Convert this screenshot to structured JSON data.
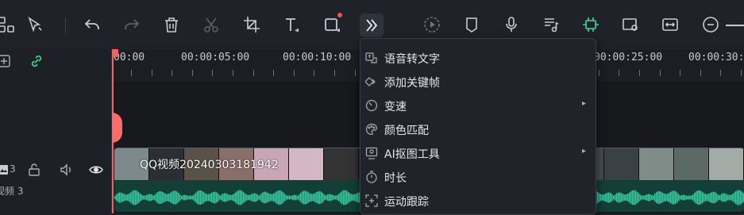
{
  "toolbar": {
    "icons": [
      "grid-icon",
      "select-arrow-icon",
      "undo-icon",
      "redo-icon",
      "delete-icon",
      "cut-icon",
      "crop-icon",
      "text-icon",
      "shape-icon",
      "more-tools-icon",
      "play-circle-icon",
      "marker-icon",
      "microphone-icon",
      "music-list-icon",
      "ai-icon",
      "render-preview-icon",
      "fit-icon",
      "zoom-out-icon"
    ],
    "accent": "#3ddc97"
  },
  "ruler": {
    "labels": [
      "00:00",
      "00:00:05:00",
      "00:00:10:00",
      "00:00:25:00",
      "00:00:30:0"
    ]
  },
  "track": {
    "number": "3",
    "name": "视频 3"
  },
  "clip": {
    "title": "QQ视频20240303181942"
  },
  "context_menu": {
    "items": [
      {
        "label": "语音转文字",
        "icon": "speech-to-text-icon",
        "submenu": false
      },
      {
        "label": "添加关键帧",
        "icon": "keyframe-icon",
        "submenu": false
      },
      {
        "label": "变速",
        "icon": "speed-icon",
        "submenu": true
      },
      {
        "label": "颜色匹配",
        "icon": "palette-icon",
        "submenu": false
      },
      {
        "label": "AI抠图工具",
        "icon": "ai-cutout-icon",
        "submenu": true
      },
      {
        "label": "时长",
        "icon": "duration-icon",
        "submenu": false
      },
      {
        "label": "运动跟踪",
        "icon": "motion-tracking-icon",
        "submenu": false
      }
    ],
    "submenu_arrow": "▸"
  },
  "colors": {
    "playhead": "#ff5f5f",
    "audio_wave": "#49c7a7"
  }
}
